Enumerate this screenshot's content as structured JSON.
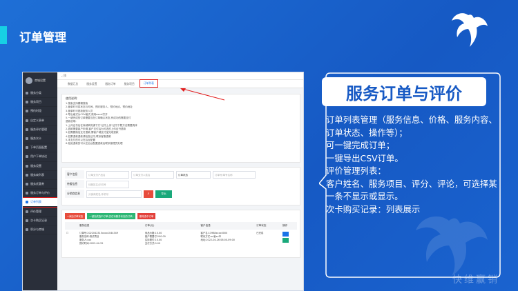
{
  "slide": {
    "title": "订单管理",
    "watermark": "快维赢销"
  },
  "screenshot": {
    "sidebar": {
      "user": "商城设置",
      "items": [
        {
          "label": "服务分类",
          "active": false
        },
        {
          "label": "服务项目",
          "active": false
        },
        {
          "label": "预约时段",
          "active": false
        },
        {
          "label": "自定义表单",
          "active": false
        },
        {
          "label": "服务评价管理",
          "active": false
        },
        {
          "label": "服务次卡",
          "active": false
        },
        {
          "label": "下单页面配置",
          "active": false
        },
        {
          "label": "用户下单协议",
          "active": false
        },
        {
          "label": "服务设置",
          "active": false
        },
        {
          "label": "服务商列表",
          "active": false
        },
        {
          "label": "服务优惠券",
          "active": false
        },
        {
          "label": "服务订单与评价",
          "active": false
        },
        {
          "label": "订单列表",
          "active": true
        },
        {
          "label": "评价管理",
          "active": false
        },
        {
          "label": "次卡购买记录",
          "active": false
        },
        {
          "label": "积分与商城",
          "active": false
        }
      ]
    },
    "topbar": "顶",
    "tabs": [
      {
        "label": "数据汇总",
        "active": false
      },
      {
        "label": "服务设置",
        "active": false
      },
      {
        "label": "服务订单",
        "active": false
      },
      {
        "label": "服务项目",
        "active": false
      },
      {
        "label": "订单列表",
        "active": true
      }
    ],
    "help": {
      "title": "使用说明:",
      "lines": [
        "1.搜索支持模糊搜索",
        "2.营单时可将状态与时间、预约服务人、预约地点、预约地址",
        "3.营单时可更新服务人员",
        "4.导出格式为CSV格式,请用excel打开",
        "5.一键完成的订单需要当在订单确认状态,有成功的需要支付",
        "退款说明:",
        "1.上传证书后在商城单的操下方\"证书上传\"证书下载方法需要具体",
        "2.退款需要客户申请,客户支付后为可选的上传证书退款",
        "3.如需要微信支付退款,需客户端支付宝完成退款",
        "4.如果退款退款请检查证书,联系客服退款",
        "5.本支付的可以在后台配置",
        "6.拒绝退款的可以在后台配置退款后联系管理员处理"
      ]
    },
    "filters": {
      "customer_label": "客户信息",
      "customer_placeholder_1": "订单支付产品名",
      "customer_placeholder_2": "订单支付人姓名",
      "order_status_select": "订单状态",
      "order_no_placeholder": "订单号/单号名称",
      "worker_label": "待服信息",
      "worker_placeholder": "待服姓名/手机号",
      "service_label": "分销商信息",
      "service_placeholder": "分销商姓名/手机号",
      "search_icon": "search-icon",
      "export_label": "导出"
    },
    "list": {
      "actions": [
        "+添加订单状态",
        "一键完成选中订单(仅在待服务状态的订单)",
        "删除选中订单"
      ],
      "columns": [
        "",
        "服务信息",
        "订单(元)",
        "客户信息",
        "订单状态",
        "操作"
      ],
      "row": {
        "service": [
          "订单号:2022042315xxxx1044349",
          "服务名称:测试项目",
          "服务人:xxx",
          "预约时间:2022-04-25"
        ],
        "order": [
          "商品价格:10.00",
          "客户需要付:200.00",
          "实际需付:10.00",
          "支付方式:0.00"
        ],
        "customer": [
          "客户名:13988xxxx0000",
          "联系方式:xx省xx市",
          "地址:2022-04-26 08:00-09:00"
        ],
        "status": "已完成"
      }
    }
  },
  "panel": {
    "headline": "服务订单与评价",
    "lines": [
      "订单列表管理（服务信息、价格、服务内容、订单状态、操作等）；",
      "可一键完成订单；",
      "一键导出CSV订单。",
      "评价管理列表：",
      "客户姓名、服务项目、评分、评论，可选择某一条不显示或显示。",
      "次卡购买记录：列表展示"
    ]
  }
}
